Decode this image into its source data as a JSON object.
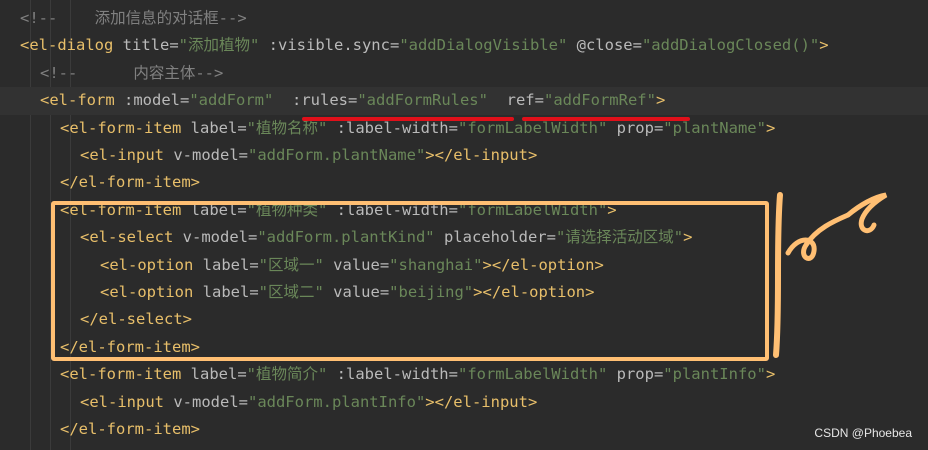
{
  "code_lines": [
    {
      "indent": "",
      "segments": [
        {
          "cls": "c",
          "text": "<!--    添加信息的对话框-->"
        }
      ]
    },
    {
      "indent": "",
      "segments": [
        {
          "cls": "t",
          "text": "<el-dialog "
        },
        {
          "cls": "a",
          "text": "title="
        },
        {
          "cls": "s",
          "text": "\"添加植物\""
        },
        {
          "cls": "a",
          "text": " :visible.sync="
        },
        {
          "cls": "s",
          "text": "\"addDialogVisible\""
        },
        {
          "cls": "a",
          "text": " @close="
        },
        {
          "cls": "s",
          "text": "\"addDialogClosed()\""
        },
        {
          "cls": "t",
          "text": ">"
        }
      ]
    },
    {
      "indent": "  ",
      "segments": [
        {
          "cls": "c",
          "text": "<!--      内容主体-->"
        }
      ]
    },
    {
      "indent": "  ",
      "highlight": true,
      "segments": [
        {
          "cls": "t",
          "text": "<el-form "
        },
        {
          "cls": "a",
          "text": ":model="
        },
        {
          "cls": "s",
          "text": "\"addForm\""
        },
        {
          "cls": "a",
          "text": "  :rules="
        },
        {
          "cls": "s",
          "text": "\"addFormRules\""
        },
        {
          "cls": "a",
          "text": "  ref="
        },
        {
          "cls": "s",
          "text": "\"addFormRef\""
        },
        {
          "cls": "t",
          "text": ">"
        }
      ]
    },
    {
      "indent": "    ",
      "segments": [
        {
          "cls": "t",
          "text": "<el-form-item "
        },
        {
          "cls": "a",
          "text": "label="
        },
        {
          "cls": "s",
          "text": "\"植物名称\""
        },
        {
          "cls": "a",
          "text": " :label-width="
        },
        {
          "cls": "s",
          "text": "\"formLabelWidth\""
        },
        {
          "cls": "a",
          "text": " prop="
        },
        {
          "cls": "s",
          "text": "\"plantName\""
        },
        {
          "cls": "t",
          "text": ">"
        }
      ]
    },
    {
      "indent": "      ",
      "segments": [
        {
          "cls": "t",
          "text": "<el-input "
        },
        {
          "cls": "a",
          "text": "v-model="
        },
        {
          "cls": "s",
          "text": "\"addForm.plantName\""
        },
        {
          "cls": "t",
          "text": "></el-input>"
        }
      ]
    },
    {
      "indent": "    ",
      "segments": [
        {
          "cls": "t",
          "text": "</el-form-item>"
        }
      ]
    },
    {
      "indent": "    ",
      "segments": [
        {
          "cls": "t",
          "text": "<el-form-item "
        },
        {
          "cls": "a",
          "text": "label="
        },
        {
          "cls": "s",
          "text": "\"植物种类\""
        },
        {
          "cls": "a",
          "text": " :label-width="
        },
        {
          "cls": "s",
          "text": "\"formLabelWidth\""
        },
        {
          "cls": "t",
          "text": ">"
        }
      ]
    },
    {
      "indent": "      ",
      "segments": [
        {
          "cls": "t",
          "text": "<el-select "
        },
        {
          "cls": "a",
          "text": "v-model="
        },
        {
          "cls": "s",
          "text": "\"addForm.plantKind\""
        },
        {
          "cls": "a",
          "text": " placeholder="
        },
        {
          "cls": "s",
          "text": "\"请选择活动区域\""
        },
        {
          "cls": "t",
          "text": ">"
        }
      ]
    },
    {
      "indent": "        ",
      "segments": [
        {
          "cls": "t",
          "text": "<el-option "
        },
        {
          "cls": "a",
          "text": "label="
        },
        {
          "cls": "s",
          "text": "\"区域一\""
        },
        {
          "cls": "a",
          "text": " value="
        },
        {
          "cls": "s",
          "text": "\"shanghai\""
        },
        {
          "cls": "t",
          "text": "></el-option>"
        }
      ]
    },
    {
      "indent": "        ",
      "segments": [
        {
          "cls": "t",
          "text": "<el-option "
        },
        {
          "cls": "a",
          "text": "label="
        },
        {
          "cls": "s",
          "text": "\"区域二\""
        },
        {
          "cls": "a",
          "text": " value="
        },
        {
          "cls": "s",
          "text": "\"beijing\""
        },
        {
          "cls": "t",
          "text": "></el-option>"
        }
      ]
    },
    {
      "indent": "      ",
      "segments": [
        {
          "cls": "t",
          "text": "</el-select>"
        }
      ]
    },
    {
      "indent": "    ",
      "segments": [
        {
          "cls": "t",
          "text": "</el-form-item>"
        }
      ]
    },
    {
      "indent": "    ",
      "segments": [
        {
          "cls": "t",
          "text": "<el-form-item "
        },
        {
          "cls": "a",
          "text": "label="
        },
        {
          "cls": "s",
          "text": "\"植物简介\""
        },
        {
          "cls": "a",
          "text": " :label-width="
        },
        {
          "cls": "s",
          "text": "\"formLabelWidth\""
        },
        {
          "cls": "a",
          "text": " prop="
        },
        {
          "cls": "s",
          "text": "\"plantInfo\""
        },
        {
          "cls": "t",
          "text": ">"
        }
      ]
    },
    {
      "indent": "      ",
      "segments": [
        {
          "cls": "t",
          "text": "<el-input "
        },
        {
          "cls": "a",
          "text": "v-model="
        },
        {
          "cls": "s",
          "text": "\"addForm.plantInfo\""
        },
        {
          "cls": "t",
          "text": "></el-input>"
        }
      ]
    },
    {
      "indent": "    ",
      "segments": [
        {
          "cls": "t",
          "text": "</el-form-item>"
        }
      ]
    }
  ],
  "watermark": "CSDN @Phoebea",
  "colors": {
    "background": "#2b2b2b",
    "tag": "#e8bf6a",
    "string": "#6a8759",
    "comment": "#808080",
    "annotation_red": "#e0101a",
    "annotation_orange": "#ffbf73"
  }
}
